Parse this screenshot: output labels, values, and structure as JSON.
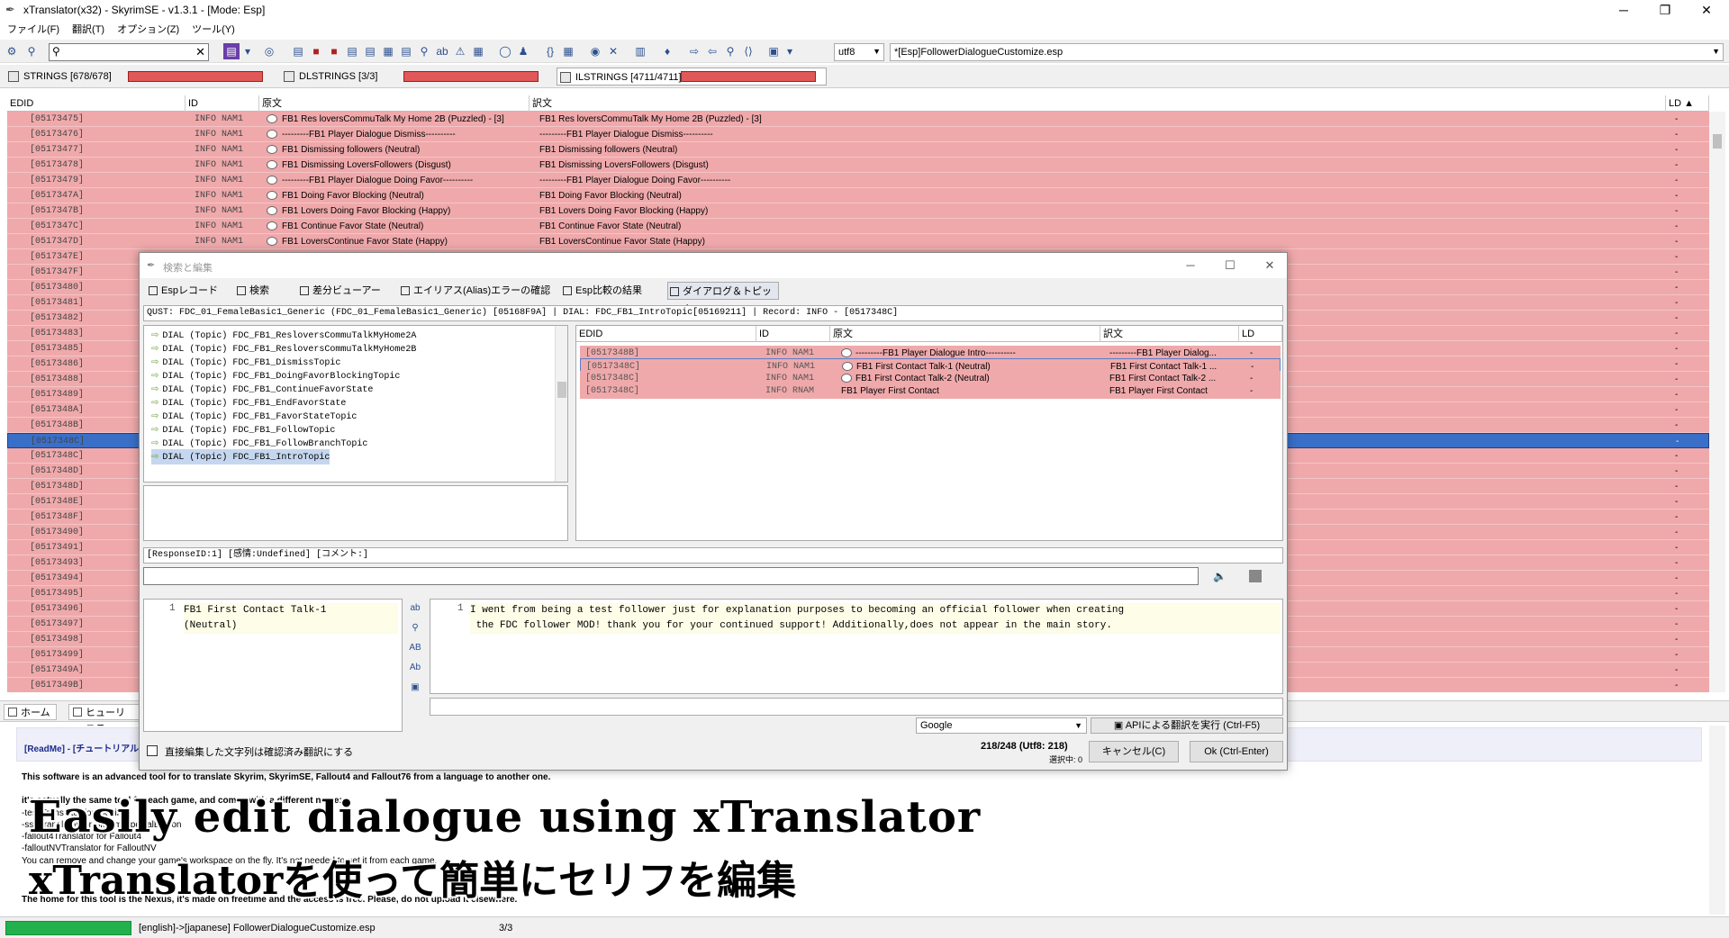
{
  "window": {
    "title": "xTranslator(x32) - SkyrimSE - v1.3.1 - [Mode: Esp]",
    "minimize": "─",
    "restore": "❐",
    "close": "✕"
  },
  "menu": [
    "ファイル(F)",
    "翻訳(T)",
    "オプション(Z)",
    "ツール(Y)"
  ],
  "toolbar": {
    "search_value": "",
    "encoding": "utf8",
    "file": "*[Esp]FollowerDialogueCustomize.esp"
  },
  "string_tabs": [
    {
      "label": "STRINGS [678/678]",
      "progress": 1.0
    },
    {
      "label": "DLSTRINGS [3/3]",
      "progress": 1.0
    },
    {
      "label": "ILSTRINGS [4711/4711]",
      "progress": 1.0
    }
  ],
  "grid": {
    "headers": {
      "edid": "EDID",
      "id": "ID",
      "source": "原文",
      "translation": "訳文",
      "ld": "LD ▲"
    },
    "rows": [
      {
        "edid": "[05173475]",
        "id": "INFO NAM1",
        "src": "FB1 Res loversCommuTalk My Home 2B (Puzzled) - [3]",
        "tr": "FB1 Res loversCommuTalk My Home 2B (Puzzled) - [3]",
        "ld": "-"
      },
      {
        "edid": "[05173476]",
        "id": "INFO NAM1",
        "src": "---------FB1 Player Dialogue Dismiss----------",
        "tr": "---------FB1 Player Dialogue Dismiss----------",
        "ld": "-"
      },
      {
        "edid": "[05173477]",
        "id": "INFO NAM1",
        "src": "FB1 Dismissing followers (Neutral)",
        "tr": "FB1 Dismissing followers (Neutral)",
        "ld": "-"
      },
      {
        "edid": "[05173478]",
        "id": "INFO NAM1",
        "src": "FB1 Dismissing LoversFollowers (Disgust)",
        "tr": "FB1 Dismissing LoversFollowers (Disgust)",
        "ld": "-"
      },
      {
        "edid": "[05173479]",
        "id": "INFO NAM1",
        "src": "---------FB1 Player Dialogue Doing Favor----------",
        "tr": "---------FB1 Player Dialogue Doing Favor----------",
        "ld": "-"
      },
      {
        "edid": "[0517347A]",
        "id": "INFO NAM1",
        "src": "FB1 Doing Favor Blocking (Neutral)",
        "tr": "FB1 Doing Favor Blocking (Neutral)",
        "ld": "-"
      },
      {
        "edid": "[0517347B]",
        "id": "INFO NAM1",
        "src": "FB1 Lovers Doing Favor Blocking (Happy)",
        "tr": "FB1 Lovers Doing Favor Blocking (Happy)",
        "ld": "-"
      },
      {
        "edid": "[0517347C]",
        "id": "INFO NAM1",
        "src": "FB1 Continue Favor State (Neutral)",
        "tr": "FB1 Continue Favor State (Neutral)",
        "ld": "-"
      },
      {
        "edid": "[0517347D]",
        "id": "INFO NAM1",
        "src": "FB1 LoversContinue Favor State (Happy)",
        "tr": "FB1 LoversContinue Favor State (Happy)",
        "ld": "-"
      },
      {
        "edid": "[0517347E]",
        "id": "INFO NAM1",
        "src": "FB1 End Favor State (Neutral)",
        "tr": "FB1 End Favor State (Neutral)",
        "ld": "-"
      },
      {
        "edid": "[0517347F]",
        "id": "",
        "src": "",
        "tr": "",
        "ld": "-"
      },
      {
        "edid": "[05173480]",
        "id": "",
        "src": "",
        "tr": "",
        "ld": "-"
      },
      {
        "edid": "[05173481]",
        "id": "",
        "src": "",
        "tr": "",
        "ld": "-"
      },
      {
        "edid": "[05173482]",
        "id": "",
        "src": "",
        "tr": "",
        "ld": "-"
      },
      {
        "edid": "[05173483]",
        "id": "",
        "src": "",
        "tr": "",
        "ld": "-"
      },
      {
        "edid": "[05173485]",
        "id": "",
        "src": "",
        "tr": "",
        "ld": "-"
      },
      {
        "edid": "[05173486]",
        "id": "",
        "src": "",
        "tr": "",
        "ld": "-"
      },
      {
        "edid": "[05173488]",
        "id": "",
        "src": "",
        "tr": "",
        "ld": "-"
      },
      {
        "edid": "[05173489]",
        "id": "",
        "src": "",
        "tr": "",
        "ld": "-"
      },
      {
        "edid": "[0517348A]",
        "id": "",
        "src": "",
        "tr": "",
        "ld": "-"
      },
      {
        "edid": "[0517348B]",
        "id": "",
        "src": "",
        "tr": "",
        "ld": "-"
      },
      {
        "edid": "[0517348C]",
        "id": "",
        "src": "",
        "tr": "",
        "ld": "-"
      },
      {
        "edid": "[0517348C]",
        "id": "",
        "src": "",
        "tr": "",
        "ld": "-"
      },
      {
        "edid": "[0517348D]",
        "id": "",
        "src": "",
        "tr": "",
        "ld": "-"
      },
      {
        "edid": "[0517348D]",
        "id": "",
        "src": "",
        "tr": "",
        "ld": "-"
      },
      {
        "edid": "[0517348E]",
        "id": "",
        "src": "",
        "tr": "",
        "ld": "-"
      },
      {
        "edid": "[0517348F]",
        "id": "",
        "src": "",
        "tr": "",
        "ld": "-"
      },
      {
        "edid": "[05173490]",
        "id": "",
        "src": "",
        "tr": "",
        "ld": "-"
      },
      {
        "edid": "[05173491]",
        "id": "",
        "src": "",
        "tr": "",
        "ld": "-"
      },
      {
        "edid": "[05173493]",
        "id": "",
        "src": "",
        "tr": "",
        "ld": "-"
      },
      {
        "edid": "[05173494]",
        "id": "",
        "src": "",
        "tr": "",
        "ld": "-"
      },
      {
        "edid": "[05173495]",
        "id": "",
        "src": "",
        "tr": "",
        "ld": "-"
      },
      {
        "edid": "[05173496]",
        "id": "",
        "src": "",
        "tr": "",
        "ld": "-"
      },
      {
        "edid": "[05173497]",
        "id": "",
        "src": "",
        "tr": "",
        "ld": "-"
      },
      {
        "edid": "[05173498]",
        "id": "",
        "src": "",
        "tr": "",
        "ld": "-"
      },
      {
        "edid": "[05173499]",
        "id": "",
        "src": "",
        "tr": "",
        "ld": "-"
      },
      {
        "edid": "[0517349A]",
        "id": "",
        "src": "",
        "tr": "",
        "ld": "-"
      },
      {
        "edid": "[0517349B]",
        "id": "",
        "src": "",
        "tr": "",
        "ld": "-"
      }
    ],
    "selected_index": 21
  },
  "bottom_tabs": [
    "ホーム",
    "ヒューリステ"
  ],
  "readme": {
    "header": "[ReadMe] - [チュートリアル",
    "lines": [
      "This software is an advanced tool for to translate Skyrim, SkyrimSE, Fallout4 and Fallout76 from a language to another one.",
      "",
      "it's actually the same tool for each game, and comes with a different name:",
      "-tesvTranslator for Skyrim",
      "-sseTranslator for Skyrim SpecialEdition",
      "-fallout4Translator for Fallout4",
      "-falloutNVTranslator for FalloutNV",
      "You can remove and change your game's workspace on the fly. It's not needed to get it from each game.",
      "",
      "The home for this tool is the Nexus, it's made on freetime and the access is free. Please, do not upload it elsewhere."
    ]
  },
  "caption": {
    "line1": "Easily edit dialogue using xTranslator",
    "line2": "xTranslatorを使って簡単にセリフを編集"
  },
  "status": {
    "lang": "[english]->[japanese] FollowerDialogueCustomize.esp",
    "count": "3/3"
  },
  "dialog": {
    "title": "検索と編集",
    "tabs": [
      "Espレコード",
      "検索",
      "差分ビューアー",
      "エイリアス(Alias)エラーの確認",
      "Esp比較の結果",
      "ダイアログ＆トピック"
    ],
    "active_tab": 5,
    "quest_bar": "QUST: FDC_01_FemaleBasic1_Generic (FDC_01_FemaleBasic1_Generic) [05168F9A] | DIAL: FDC_FB1_IntroTopic[05169211] | Record: INFO - [0517348C]",
    "tree": [
      "DIAL (Topic) FDC_FB1_ResloversCommuTalkMyHome2A",
      "DIAL (Topic) FDC_FB1_ResloversCommuTalkMyHome2B",
      "DIAL (Topic) FDC_FB1_DismissTopic",
      "DIAL (Topic) FDC_FB1_DoingFavorBlockingTopic",
      "DIAL (Topic) FDC_FB1_ContinueFavorState",
      "DIAL (Topic) FDC_FB1_EndFavorState",
      "DIAL (Topic) FDC_FB1_FavorStateTopic",
      "DIAL (Topic) FDC_FB1_FollowTopic",
      "DIAL (Topic) FDC_FB1_FollowBranchTopic",
      "DIAL (Topic) FDC_FB1_IntroTopic"
    ],
    "tree_selected": 9,
    "sub_headers": {
      "edid": "EDID",
      "id": "ID",
      "source": "原文",
      "translation": "訳文",
      "ld": "LD"
    },
    "sub_rows": [
      {
        "edid": "[0517348B]",
        "id": "INFO NAM1",
        "src": "---------FB1 Player Dialogue Intro----------",
        "tr": "---------FB1 Player Dialog...",
        "ld": "-",
        "bubble": true
      },
      {
        "edid": "[0517348C]",
        "id": "INFO NAM1",
        "src": "FB1 First Contact Talk-1 (Neutral)",
        "tr": "FB1 First Contact Talk-1 ...",
        "ld": "-",
        "bubble": true
      },
      {
        "edid": "[0517348C]",
        "id": "INFO NAM1",
        "src": "FB1 First Contact Talk-2 (Neutral)",
        "tr": "FB1 First Contact Talk-2 ...",
        "ld": "-",
        "bubble": true
      },
      {
        "edid": "[0517348C]",
        "id": "INFO RNAM",
        "src": "FB1 Player First Contact",
        "tr": "FB1 Player First Contact",
        "ld": "-",
        "bubble": false
      }
    ],
    "sub_selected": 1,
    "response_bar": "[ResponseID:1] [感情:Undefined] [コメント:]",
    "source_line_no": "1",
    "source_text": "FB1 First Contact Talk-1\n(Neutral)",
    "translation_line_no": "1",
    "translation_text": "I went from being a test follower just for explanation purposes to becoming an official follower when creating\n the FDC follower MOD! thank you for your continued support! Additionally,does not appear in the main story.",
    "engine": "Google",
    "api_button": "APIによる翻訳を実行 (Ctrl-F5)",
    "checkbox_label": "直接編集した文字列は確認済み翻訳にする",
    "count": "218/248 (Utf8: 218)",
    "selection": "選択中: 0",
    "cancel": "キャンセル(C)",
    "ok": "Ok (Ctrl-Enter)"
  }
}
